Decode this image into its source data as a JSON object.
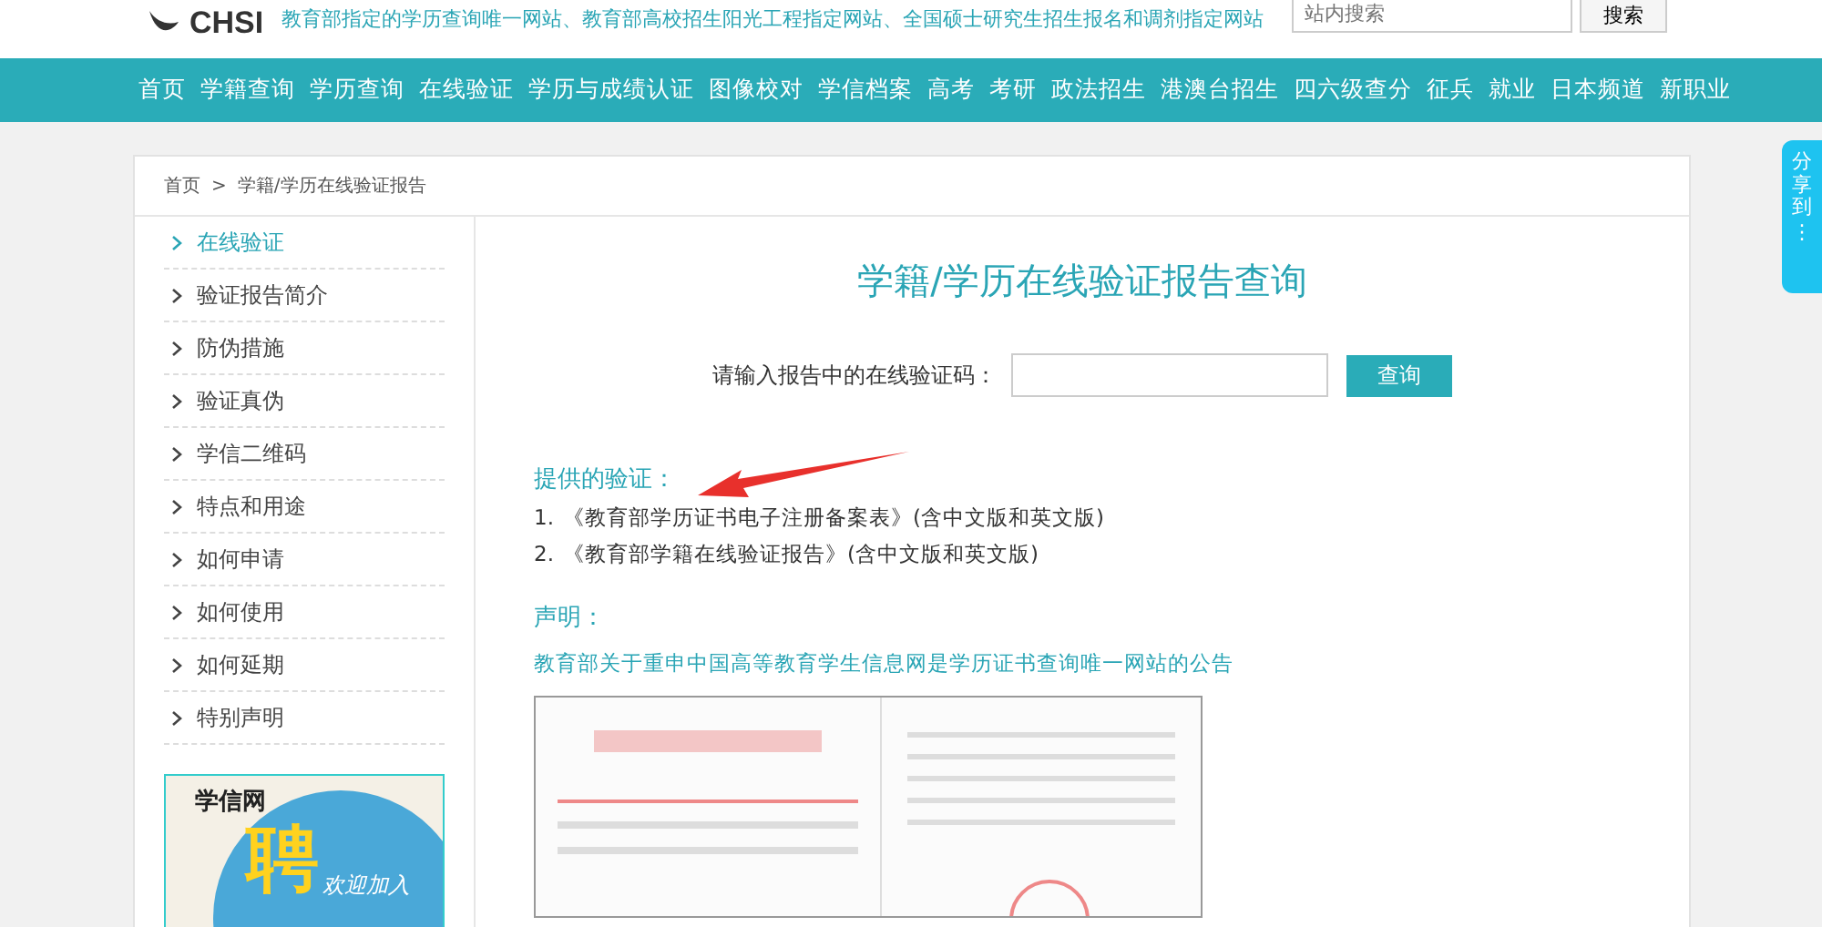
{
  "header": {
    "logo": "CHSI",
    "tagline": "教育部指定的学历查询唯一网站、教育部高校招生阳光工程指定网站、全国硕士研究生招生报名和调剂指定网站",
    "search": {
      "placeholder": "站内搜索"
    },
    "search_button": "搜索"
  },
  "nav": [
    "首页",
    "学籍查询",
    "学历查询",
    "在线验证",
    "学历与成绩认证",
    "图像校对",
    "学信档案",
    "高考",
    "考研",
    "政法招生",
    "港澳台招生",
    "四六级查分",
    "征兵",
    "就业",
    "日本频道",
    "新职业"
  ],
  "breadcrumb": [
    "首页",
    ">",
    "学籍/学历在线验证报告"
  ],
  "sidebar": {
    "items": [
      {
        "label": "在线验证",
        "selected": true
      },
      {
        "label": "验证报告简介",
        "selected": false
      },
      {
        "label": "防伪措施",
        "selected": false
      },
      {
        "label": "验证真伪",
        "selected": false
      },
      {
        "label": "学信二维码",
        "selected": false
      },
      {
        "label": "特点和用途",
        "selected": false
      },
      {
        "label": "如何申请",
        "selected": false
      },
      {
        "label": "如何使用",
        "selected": false
      },
      {
        "label": "如何延期",
        "selected": false
      },
      {
        "label": "特别声明",
        "selected": false
      }
    ],
    "banner": {
      "brand": "学信网",
      "big": "聘",
      "slogan": "欢迎加入"
    }
  },
  "main": {
    "title": "学籍/学历在线验证报告查询",
    "form": {
      "label": "请输入报告中的在线验证码：",
      "button": "查询"
    },
    "provided_heading": "提供的验证：",
    "provided": [
      {
        "number": "1.",
        "text": "《教育部学历证书电子注册备案表》(含中文版和英文版)"
      },
      {
        "number": "2.",
        "text": "《教育部学籍在线验证报告》(含中文版和英文版)"
      }
    ],
    "statement_heading": "声明：",
    "statement_link": "教育部关于重申中国高等教育学生信息网是学历证书查询唯一网站的公告"
  },
  "share": {
    "label": "分享到",
    "more": "⋮"
  }
}
